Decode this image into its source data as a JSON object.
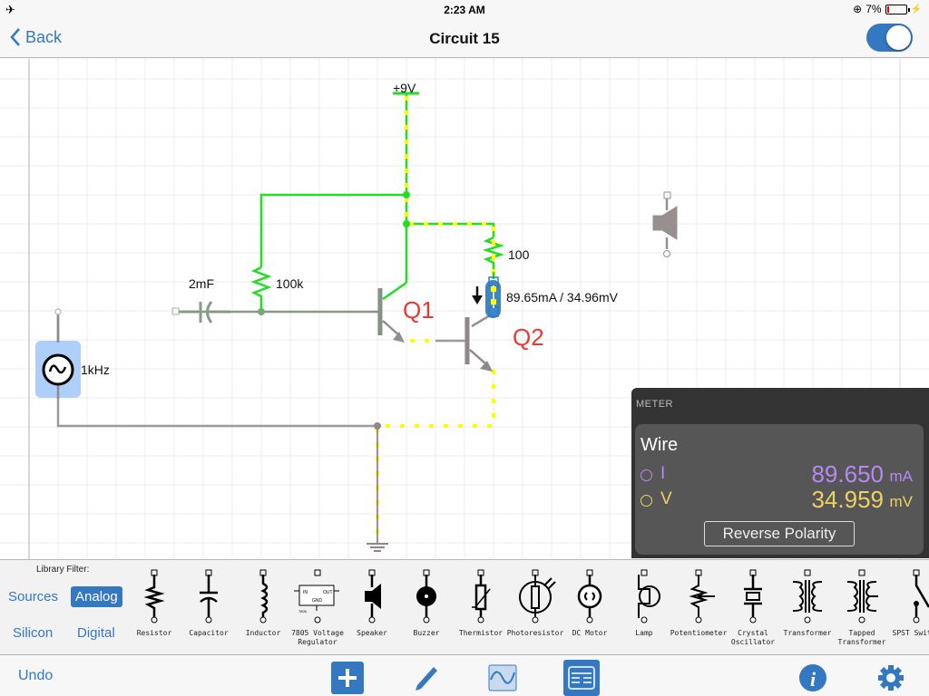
{
  "status_bar": {
    "time": "2:23 AM",
    "battery_percent": "7%",
    "airplane_icon": "airplane-icon",
    "lock_icon": "orientation-lock-icon",
    "charging_icon": "charging-bolt-icon"
  },
  "nav": {
    "back_label": "Back",
    "title": "Circuit 15",
    "toggle_on": true
  },
  "circuit": {
    "supply_label": "+9V",
    "capacitor_label": "2mF",
    "r1_label": "100k",
    "r2_label": "100",
    "q1_label": "Q1",
    "q2_label": "Q2",
    "source_label": "1kHz",
    "probe_readout": "89.65mA / 34.96mV",
    "colors": {
      "live_wire": "#22dd22",
      "current_dots": "#ffff00",
      "dead_wire": "#999999",
      "transistor_label": "#e83a2e",
      "selection": "#3478c1"
    }
  },
  "meter": {
    "header": "METER",
    "element": "Wire",
    "current": {
      "symbol": "I",
      "value": "89.650",
      "unit": "mA",
      "color": "#b58af0"
    },
    "voltage": {
      "symbol": "V",
      "value": "34.959",
      "unit": "mV",
      "color": "#f0d060"
    },
    "reverse_button": "Reverse Polarity"
  },
  "library": {
    "filter_label": "Library Filter:",
    "filters": [
      {
        "label": "Sources",
        "active": false
      },
      {
        "label": "Analog",
        "active": true
      },
      {
        "label": "Silicon",
        "active": false
      },
      {
        "label": "Digital",
        "active": false
      }
    ],
    "components": [
      {
        "name": "Resistor",
        "icon": "resistor-icon"
      },
      {
        "name": "Capacitor",
        "icon": "capacitor-icon"
      },
      {
        "name": "Inductor",
        "icon": "inductor-icon"
      },
      {
        "name": "7805 Voltage Regulator",
        "icon": "voltage-regulator-icon"
      },
      {
        "name": "Speaker",
        "icon": "speaker-icon"
      },
      {
        "name": "Buzzer",
        "icon": "buzzer-icon"
      },
      {
        "name": "Thermistor",
        "icon": "thermistor-icon"
      },
      {
        "name": "Photoresistor",
        "icon": "photoresistor-icon"
      },
      {
        "name": "DC Motor",
        "icon": "dc-motor-icon"
      },
      {
        "name": "Lamp",
        "icon": "lamp-icon"
      },
      {
        "name": "Potentiometer",
        "icon": "potentiometer-icon"
      },
      {
        "name": "Crystal Oscillator",
        "icon": "crystal-oscillator-icon"
      },
      {
        "name": "Transformer",
        "icon": "transformer-icon"
      },
      {
        "name": "Tapped Transformer",
        "icon": "tapped-transformer-icon"
      },
      {
        "name": "SPST Switch",
        "icon": "spst-switch-icon"
      }
    ]
  },
  "toolbar": {
    "undo_label": "Undo"
  }
}
